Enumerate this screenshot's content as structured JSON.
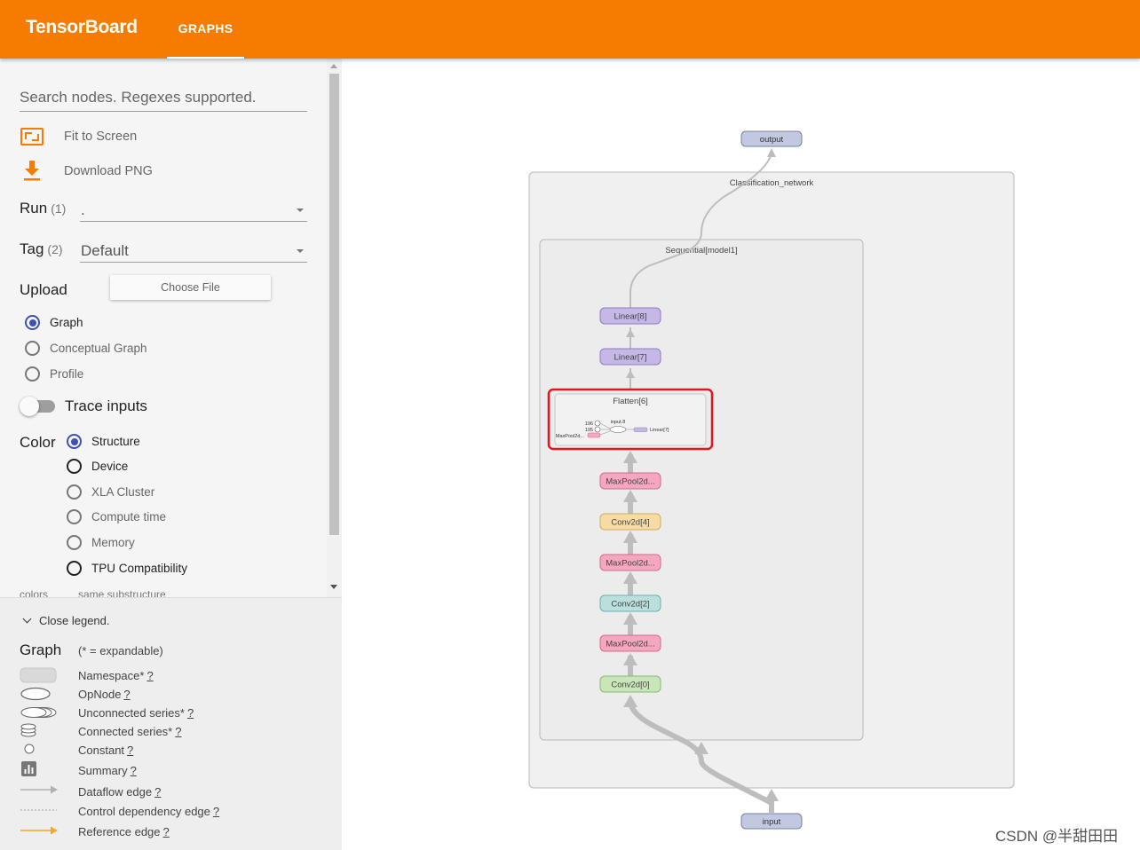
{
  "header": {
    "brand": "TensorBoard",
    "tab": "GRAPHS"
  },
  "sidebar": {
    "search_placeholder": "Search nodes. Regexes supported.",
    "fit_to_screen": "Fit to Screen",
    "download_png": "Download PNG",
    "run": {
      "label": "Run",
      "count": "(1)",
      "value": "."
    },
    "tag": {
      "label": "Tag",
      "count": "(2)",
      "value": "Default"
    },
    "upload": {
      "label": "Upload",
      "button": "Choose File"
    },
    "graph_types": [
      {
        "label": "Graph",
        "checked": true
      },
      {
        "label": "Conceptual Graph",
        "checked": false
      },
      {
        "label": "Profile",
        "checked": false
      }
    ],
    "trace_inputs": "Trace inputs",
    "color": {
      "label": "Color",
      "options": [
        {
          "label": "Structure",
          "checked": true
        },
        {
          "label": "Device",
          "checked": false
        },
        {
          "label": "XLA Cluster",
          "checked": false
        },
        {
          "label": "Compute time",
          "checked": false
        },
        {
          "label": "Memory",
          "checked": false
        },
        {
          "label": "TPU Compatibility",
          "checked": false
        }
      ]
    },
    "cut_left": "colors",
    "cut_right": "same substructure"
  },
  "legend": {
    "toggle": "Close legend.",
    "title": "Graph",
    "subtitle": "(* = expandable)",
    "items": [
      {
        "label": "Namespace*",
        "q": "?"
      },
      {
        "label": "OpNode",
        "q": "?"
      },
      {
        "label": "Unconnected series*",
        "q": "?"
      },
      {
        "label": "Connected series*",
        "q": "?"
      },
      {
        "label": "Constant",
        "q": "?"
      },
      {
        "label": "Summary",
        "q": "?"
      },
      {
        "label": "Dataflow edge",
        "q": "?"
      },
      {
        "label": "Control dependency edge",
        "q": "?"
      },
      {
        "label": "Reference edge",
        "q": "?"
      }
    ]
  },
  "graph": {
    "output_node": "output",
    "input_node": "input",
    "outer_namespace": "Classification_network",
    "inner_namespace": "Sequential[model1]",
    "layers": [
      {
        "label": "Linear[8]",
        "fill": "#c5b8e6",
        "stroke": "#8e7cc3"
      },
      {
        "label": "Linear[7]",
        "fill": "#c5b8e6",
        "stroke": "#8e7cc3"
      },
      {
        "label": "MaxPool2d...",
        "fill": "#f4a7be",
        "stroke": "#d36b8c"
      },
      {
        "label": "Conv2d[4]",
        "fill": "#f6dca4",
        "stroke": "#d2ac5a"
      },
      {
        "label": "MaxPool2d...",
        "fill": "#f4a7be",
        "stroke": "#d36b8c"
      },
      {
        "label": "Conv2d[2]",
        "fill": "#b9e0dd",
        "stroke": "#6fb0aa"
      },
      {
        "label": "MaxPool2d...",
        "fill": "#f4a7be",
        "stroke": "#d36b8c"
      },
      {
        "label": "Conv2d[0]",
        "fill": "#c8e6b8",
        "stroke": "#87bb6c"
      }
    ],
    "flatten": {
      "label": "Flatten[6]",
      "const_a": "196",
      "const_b": "195",
      "op": "input.8",
      "from": "MaxPool2d...",
      "to": "Linear[7]"
    },
    "highlight_color": "#e5161d"
  },
  "watermark": "CSDN @半甜田田"
}
